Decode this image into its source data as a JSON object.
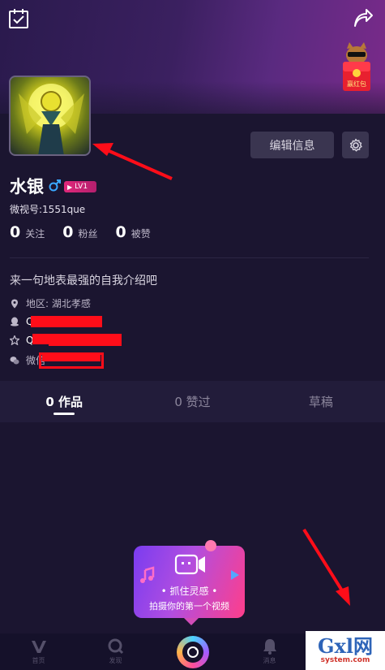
{
  "colors": {
    "accent_pink": "#e0287a",
    "annotation_red": "#ff0d19",
    "background": "#1b1530",
    "tab_bar": "#221c3a"
  },
  "header": {
    "left_icon": "checklist-icon",
    "right_icon": "share-icon",
    "promo_label": "赢红包"
  },
  "profile": {
    "edit_button": "编辑信息",
    "username": "水银",
    "gender_icon": "male-icon",
    "level": "LV1",
    "weishi_id": "微视号:1551que",
    "stats": [
      {
        "num": "0",
        "label": "关注"
      },
      {
        "num": "0",
        "label": "粉丝"
      },
      {
        "num": "0",
        "label": "被赞"
      }
    ],
    "bio": "来一句地表最强的自我介绍吧",
    "region": "地区: 湖北孝感",
    "qq_prefix": "Q",
    "zone_prefix": "Q",
    "wechat_prefix": "微信"
  },
  "tabs": [
    {
      "label": "0 作品",
      "active": true
    },
    {
      "label": "0 赞过",
      "active": false
    },
    {
      "label": "草稿",
      "active": false
    }
  ],
  "tip": {
    "title": "• 抓住灵感 •",
    "subtitle": "拍摄你的第一个视频"
  },
  "nav": [
    {
      "label": "首页"
    },
    {
      "label": "发现"
    },
    {
      "label": ""
    },
    {
      "label": "消息"
    },
    {
      "label": ""
    }
  ],
  "watermark": {
    "main": "Gxl网",
    "sub": "system.com"
  }
}
